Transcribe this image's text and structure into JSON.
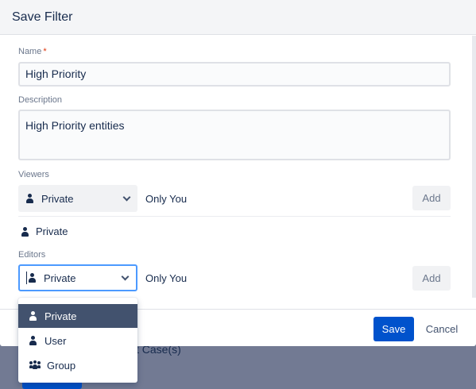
{
  "backdrop": {
    "partial_text": "t Case(s)"
  },
  "dialog": {
    "title": "Save Filter",
    "name_field": {
      "label": "Name",
      "required_marker": "*",
      "value": "High Priority"
    },
    "description_field": {
      "label": "Description",
      "value": "High Priority entities"
    },
    "viewers": {
      "label": "Viewers",
      "select_value": "Private",
      "scope_text": "Only You",
      "add_label": "Add",
      "current_entry": "Private"
    },
    "editors": {
      "label": "Editors",
      "select_value": "Private",
      "scope_text": "Only You",
      "add_label": "Add"
    },
    "footer": {
      "save_label": "Save",
      "cancel_label": "Cancel"
    }
  },
  "editors_dropdown": {
    "selected": "Private",
    "options": [
      {
        "label": "Private",
        "icon": "person-icon"
      },
      {
        "label": "User",
        "icon": "person-icon"
      },
      {
        "label": "Group",
        "icon": "group-icon"
      }
    ]
  },
  "colors": {
    "primary": "#0052cc",
    "focus_border": "#4c9aff",
    "menu_selected_bg": "#42526e",
    "required": "#de350b"
  }
}
